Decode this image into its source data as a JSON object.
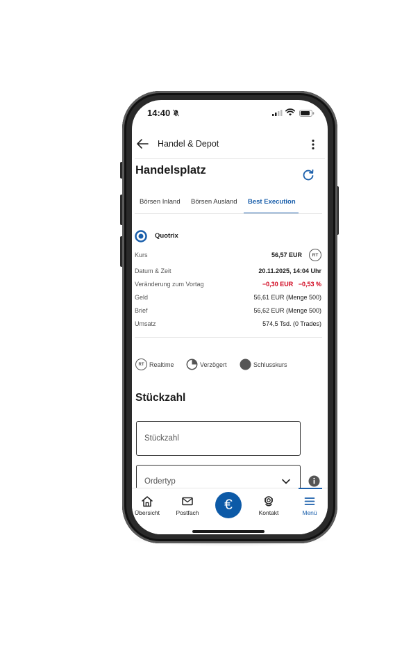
{
  "status_bar": {
    "time": "14:40"
  },
  "header": {
    "title": "Handel & Depot"
  },
  "page": {
    "title": "Handelsplatz"
  },
  "tabs": [
    {
      "label": "Börsen Inland"
    },
    {
      "label": "Börsen Ausland"
    },
    {
      "label": "Best Execution",
      "active": true
    }
  ],
  "quote": {
    "exchange": "Quotrix",
    "badge": "RT",
    "rows": [
      {
        "label": "Kurs",
        "value": "56,57 EUR"
      },
      {
        "label": "Datum & Zeit",
        "value": "20.11.2025, 14:04 Uhr"
      },
      {
        "label": "Veränderung zum Vortag",
        "value": "−0,30 EUR",
        "value2": "−0,53 %"
      },
      {
        "label": "Geld",
        "value": "56,61 EUR (Menge 500)"
      },
      {
        "label": "Brief",
        "value": "56,62 EUR (Menge 500)"
      },
      {
        "label": "Umsatz",
        "value": "574,5 Tsd. (0 Trades)"
      }
    ]
  },
  "legend": {
    "rt_badge": "RT",
    "items": [
      {
        "label": "Realtime"
      },
      {
        "label": "Verzögert"
      },
      {
        "label": "Schlusskurs"
      }
    ]
  },
  "order": {
    "section_title": "Stückzahl",
    "quantity_placeholder": "Stückzahl",
    "ordertype_label": "Ordertyp"
  },
  "bottom_nav": [
    {
      "label": "Übersicht",
      "icon": "home-icon"
    },
    {
      "label": "Postfach",
      "icon": "mail-icon"
    },
    {
      "label": "",
      "icon": "euro-icon"
    },
    {
      "label": "Kontakt",
      "icon": "contact-icon"
    },
    {
      "label": "Menü",
      "icon": "menu-icon",
      "active": true
    }
  ],
  "colors": {
    "accent": "#1a5fab",
    "negative": "#d0021b",
    "primary_button": "#0d5aa7"
  }
}
